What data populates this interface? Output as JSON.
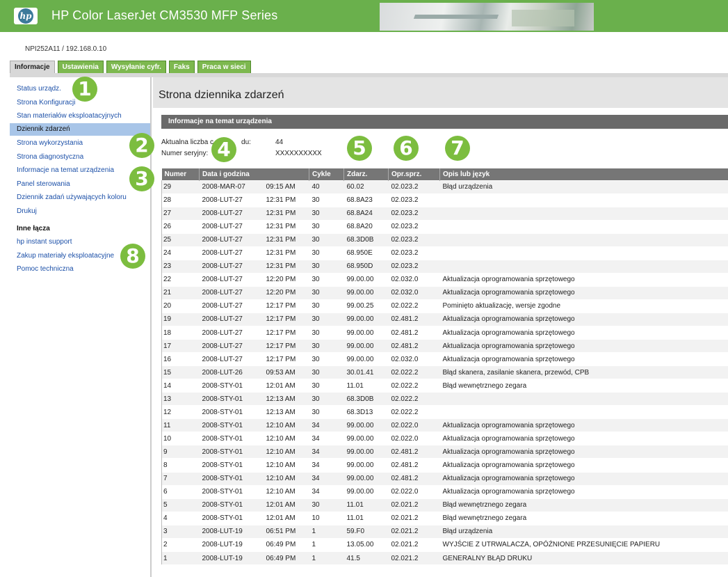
{
  "header": {
    "title": "HP Color LaserJet CM3530 MFP Series",
    "logo_text": "hp"
  },
  "address": "NPI252A11 / 192.168.0.10",
  "tabs": [
    {
      "label": "Informacje",
      "active": true
    },
    {
      "label": "Ustawienia"
    },
    {
      "label": "Wysyłanie cyfr."
    },
    {
      "label": "Faks"
    },
    {
      "label": "Praca w sieci"
    }
  ],
  "sidebar": {
    "items": [
      "Status urządz.",
      "Strona Konfiguracji",
      "Stan materiałów eksploatacyjnych",
      "Dziennik zdarzeń",
      "Strona wykorzystania",
      "Strona diagnostyczna",
      "Informacje na temat urządzenia",
      "Panel sterowania",
      "Dziennik zadań używających koloru",
      "Drukuj"
    ],
    "active_index": 3,
    "other_heading": "Inne łącza",
    "other_items": [
      "hp instant support",
      "Zakup materiały eksploatacyjne",
      "Pomoc techniczna"
    ]
  },
  "main": {
    "page_title": "Strona dziennika zdarzeń",
    "section_title": "Informacje na temat urządzenia",
    "info": {
      "count_label": "Aktualna liczba c",
      "count_label_tail": "du:",
      "count_value": "44",
      "serial_label": "Numer seryjny:",
      "serial_value": "XXXXXXXXXX"
    }
  },
  "table": {
    "headers": [
      "Numer",
      "Data i godzina",
      "",
      "Cykle",
      "Zdarz.",
      "Opr.sprz.",
      "Opis lub język"
    ],
    "rows": [
      [
        "29",
        "2008-MAR-07",
        "09:15 AM",
        "40",
        "60.02",
        "02.023.2",
        "Błąd urządzenia"
      ],
      [
        "28",
        "2008-LUT-27",
        "12:31 PM",
        "30",
        "68.8A23",
        "02.023.2",
        ""
      ],
      [
        "27",
        "2008-LUT-27",
        "12:31 PM",
        "30",
        "68.8A24",
        "02.023.2",
        ""
      ],
      [
        "26",
        "2008-LUT-27",
        "12:31 PM",
        "30",
        "68.8A20",
        "02.023.2",
        ""
      ],
      [
        "25",
        "2008-LUT-27",
        "12:31 PM",
        "30",
        "68.3D0B",
        "02.023.2",
        ""
      ],
      [
        "24",
        "2008-LUT-27",
        "12:31 PM",
        "30",
        "68.950E",
        "02.023.2",
        ""
      ],
      [
        "23",
        "2008-LUT-27",
        "12:31 PM",
        "30",
        "68.950D",
        "02.023.2",
        ""
      ],
      [
        "22",
        "2008-LUT-27",
        "12:20 PM",
        "30",
        "99.00.00",
        "02.032.0",
        "Aktualizacja oprogramowania sprzętowego"
      ],
      [
        "21",
        "2008-LUT-27",
        "12:20 PM",
        "30",
        "99.00.00",
        "02.032.0",
        "Aktualizacja oprogramowania sprzętowego"
      ],
      [
        "20",
        "2008-LUT-27",
        "12:17 PM",
        "30",
        "99.00.25",
        "02.022.2",
        "Pominięto aktualizację, wersje zgodne"
      ],
      [
        "19",
        "2008-LUT-27",
        "12:17 PM",
        "30",
        "99.00.00",
        "02.481.2",
        "Aktualizacja oprogramowania sprzętowego"
      ],
      [
        "18",
        "2008-LUT-27",
        "12:17 PM",
        "30",
        "99.00.00",
        "02.481.2",
        "Aktualizacja oprogramowania sprzętowego"
      ],
      [
        "17",
        "2008-LUT-27",
        "12:17 PM",
        "30",
        "99.00.00",
        "02.481.2",
        "Aktualizacja oprogramowania sprzętowego"
      ],
      [
        "16",
        "2008-LUT-27",
        "12:17 PM",
        "30",
        "99.00.00",
        "02.032.0",
        "Aktualizacja oprogramowania sprzętowego"
      ],
      [
        "15",
        "2008-LUT-26",
        "09:53 AM",
        "30",
        "30.01.41",
        "02.022.2",
        "Błąd skanera, zasilanie skanera, przewód, CPB"
      ],
      [
        "14",
        "2008-STY-01",
        "12:01 AM",
        "30",
        "11.01",
        "02.022.2",
        "Błąd wewnętrznego zegara"
      ],
      [
        "13",
        "2008-STY-01",
        "12:13 AM",
        "30",
        "68.3D0B",
        "02.022.2",
        ""
      ],
      [
        "12",
        "2008-STY-01",
        "12:13 AM",
        "30",
        "68.3D13",
        "02.022.2",
        ""
      ],
      [
        "11",
        "2008-STY-01",
        "12:10 AM",
        "34",
        "99.00.00",
        "02.022.0",
        "Aktualizacja oprogramowania sprzętowego"
      ],
      [
        "10",
        "2008-STY-01",
        "12:10 AM",
        "34",
        "99.00.00",
        "02.022.0",
        "Aktualizacja oprogramowania sprzętowego"
      ],
      [
        "9",
        "2008-STY-01",
        "12:10 AM",
        "34",
        "99.00.00",
        "02.481.2",
        "Aktualizacja oprogramowania sprzętowego"
      ],
      [
        "8",
        "2008-STY-01",
        "12:10 AM",
        "34",
        "99.00.00",
        "02.481.2",
        "Aktualizacja oprogramowania sprzętowego"
      ],
      [
        "7",
        "2008-STY-01",
        "12:10 AM",
        "34",
        "99.00.00",
        "02.481.2",
        "Aktualizacja oprogramowania sprzętowego"
      ],
      [
        "6",
        "2008-STY-01",
        "12:10 AM",
        "34",
        "99.00.00",
        "02.022.0",
        "Aktualizacja oprogramowania sprzętowego"
      ],
      [
        "5",
        "2008-STY-01",
        "12:01 AM",
        "30",
        "11.01",
        "02.021.2",
        "Błąd wewnętrznego zegara"
      ],
      [
        "4",
        "2008-STY-01",
        "12:01 AM",
        "10",
        "11.01",
        "02.021.2",
        "Błąd wewnętrznego zegara"
      ],
      [
        "3",
        "2008-LUT-19",
        "06:51 PM",
        "1",
        "59.F0",
        "02.021.2",
        "Błąd urządzenia"
      ],
      [
        "2",
        "2008-LUT-19",
        "06:49 PM",
        "1",
        "13.05.00",
        "02.021.2",
        "WYJŚCIE Z UTRWALACZA, OPÓŹNIONE PRZESUNIĘCIE PAPIERU"
      ],
      [
        "1",
        "2008-LUT-19",
        "06:49 PM",
        "1",
        "41.5",
        "02.021.2",
        "GENERALNY BŁĄD DRUKU"
      ]
    ]
  },
  "callouts": [
    "1",
    "2",
    "3",
    "4",
    "5",
    "6",
    "7",
    "8"
  ],
  "colors": {
    "brand_green": "#6ab04c",
    "callout_green": "#7cbd3f",
    "active_sidebar": "#a8c5e8",
    "table_header": "#767676"
  }
}
